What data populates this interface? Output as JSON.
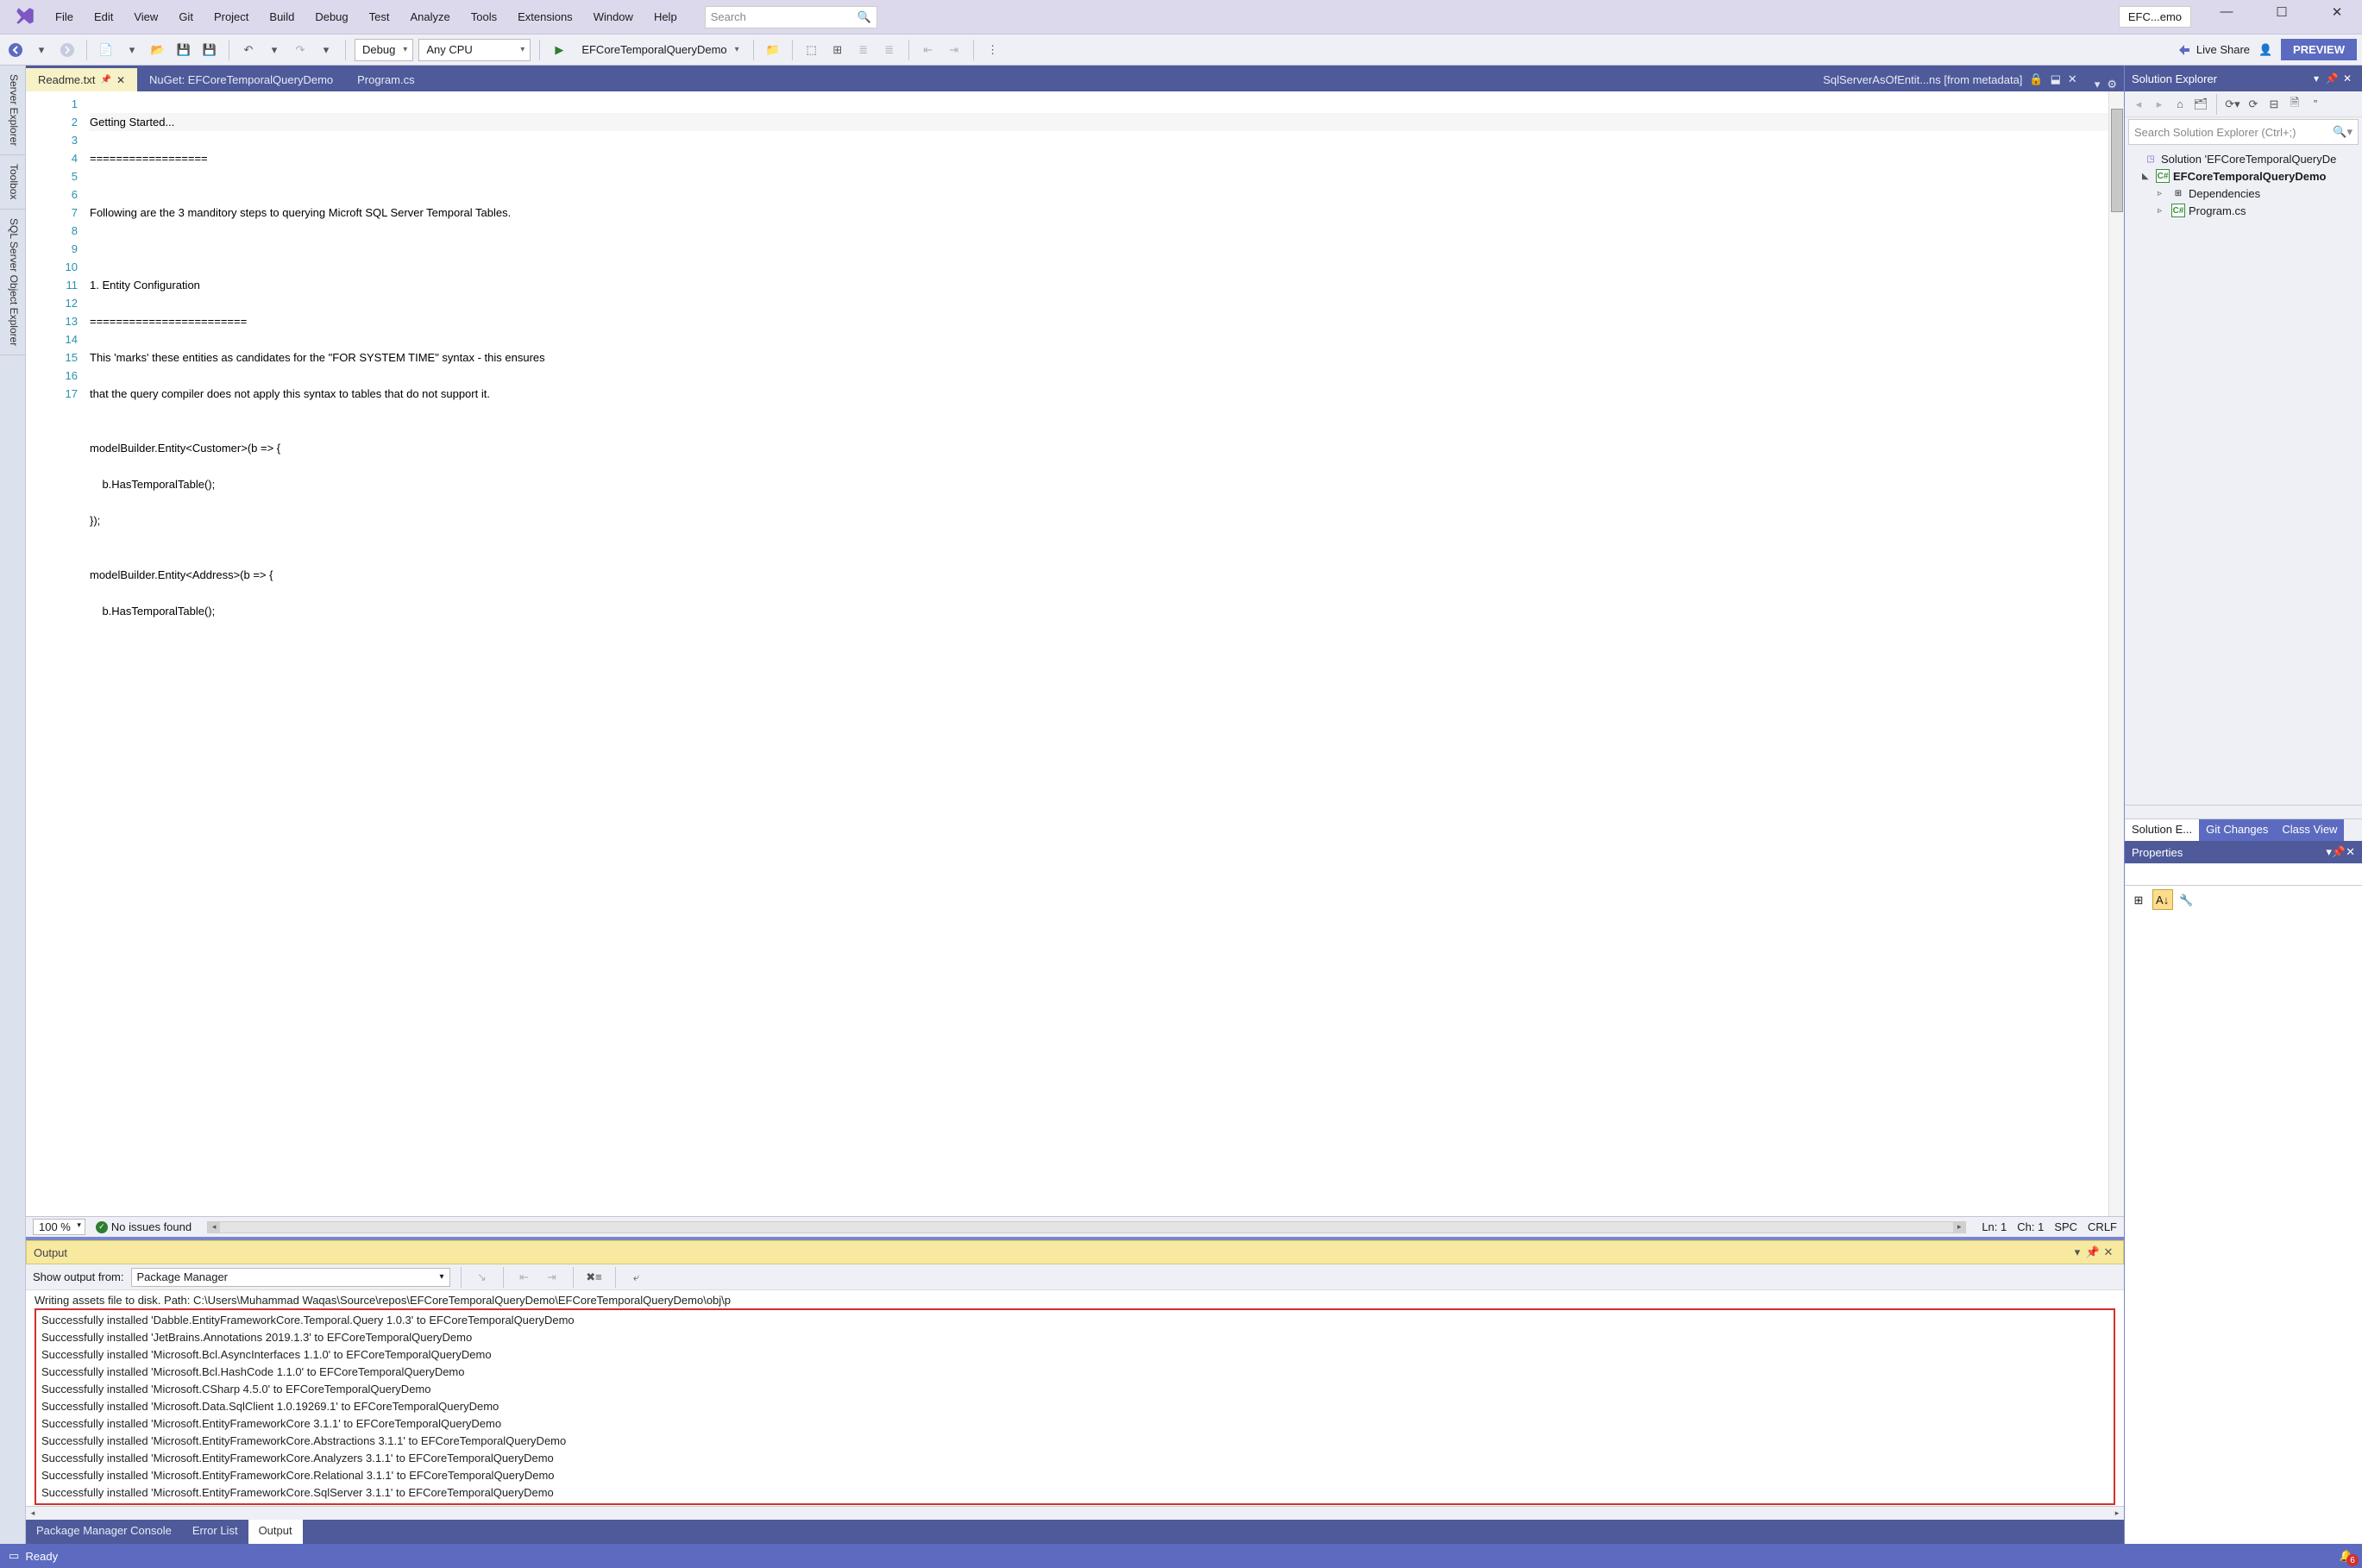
{
  "titlebar": {
    "menus": [
      "File",
      "Edit",
      "View",
      "Git",
      "Project",
      "Build",
      "Debug",
      "Test",
      "Analyze",
      "Tools",
      "Extensions",
      "Window",
      "Help"
    ],
    "search_placeholder": "Search",
    "solution_short": "EFC...emo"
  },
  "toolbar": {
    "config": "Debug",
    "platform": "Any CPU",
    "run_target": "EFCoreTemporalQueryDemo",
    "live_share": "Live Share",
    "preview": "PREVIEW"
  },
  "left_rail": [
    "Server Explorer",
    "Toolbox",
    "SQL Server Object Explorer"
  ],
  "doc_tabs": {
    "active": "Readme.txt",
    "others": [
      "NuGet: EFCoreTemporalQueryDemo",
      "Program.cs"
    ],
    "meta": "SqlServerAsOfEntit...ns [from metadata]"
  },
  "editor": {
    "lines": [
      "Getting Started...",
      "==================",
      "",
      "Following are the 3 manditory steps to querying Microft SQL Server Temporal Tables.",
      "",
      "",
      "1. Entity Configuration",
      "========================",
      "This 'marks' these entities as candidates for the \"FOR SYSTEM TIME\" syntax - this ensures",
      "that the query compiler does not apply this syntax to tables that do not support it.",
      "",
      "modelBuilder.Entity<Customer>(b => {",
      "    b.HasTemporalTable();",
      "});",
      "",
      "modelBuilder.Entity<Address>(b => {",
      "    b.HasTemporalTable();"
    ],
    "status": {
      "zoom": "100 %",
      "noissues": "No issues found",
      "ln": "Ln: 1",
      "ch": "Ch: 1",
      "ins": "SPC",
      "eol": "CRLF"
    }
  },
  "output": {
    "title": "Output",
    "from_label": "Show output from:",
    "from_value": "Package Manager",
    "first_line": "Writing assets file to disk. Path: C:\\Users\\Muhammad Waqas\\Source\\repos\\EFCoreTemporalQueryDemo\\EFCoreTemporalQueryDemo\\obj\\p",
    "boxed_lines": [
      "Successfully installed 'Dabble.EntityFrameworkCore.Temporal.Query 1.0.3' to EFCoreTemporalQueryDemo",
      "Successfully installed 'JetBrains.Annotations 2019.1.3' to EFCoreTemporalQueryDemo",
      "Successfully installed 'Microsoft.Bcl.AsyncInterfaces 1.1.0' to EFCoreTemporalQueryDemo",
      "Successfully installed 'Microsoft.Bcl.HashCode 1.1.0' to EFCoreTemporalQueryDemo",
      "Successfully installed 'Microsoft.CSharp 4.5.0' to EFCoreTemporalQueryDemo",
      "Successfully installed 'Microsoft.Data.SqlClient 1.0.19269.1' to EFCoreTemporalQueryDemo",
      "Successfully installed 'Microsoft.EntityFrameworkCore 3.1.1' to EFCoreTemporalQueryDemo",
      "Successfully installed 'Microsoft.EntityFrameworkCore.Abstractions 3.1.1' to EFCoreTemporalQueryDemo",
      "Successfully installed 'Microsoft.EntityFrameworkCore.Analyzers 3.1.1' to EFCoreTemporalQueryDemo",
      "Successfully installed 'Microsoft.EntityFrameworkCore.Relational 3.1.1' to EFCoreTemporalQueryDemo",
      "Successfully installed 'Microsoft.EntityFrameworkCore.SqlServer 3.1.1' to EFCoreTemporalQueryDemo"
    ]
  },
  "bottom_tabs": [
    "Package Manager Console",
    "Error List",
    "Output"
  ],
  "solution_explorer": {
    "title": "Solution Explorer",
    "search_placeholder": "Search Solution Explorer (Ctrl+;)",
    "root": "Solution 'EFCoreTemporalQueryDe",
    "project": "EFCoreTemporalQueryDemo",
    "children": [
      "Dependencies",
      "Program.cs"
    ],
    "tabs": [
      "Solution E...",
      "Git Changes",
      "Class View"
    ]
  },
  "properties": {
    "title": "Properties"
  },
  "statusbar": {
    "ready": "Ready",
    "notif_count": "6"
  }
}
